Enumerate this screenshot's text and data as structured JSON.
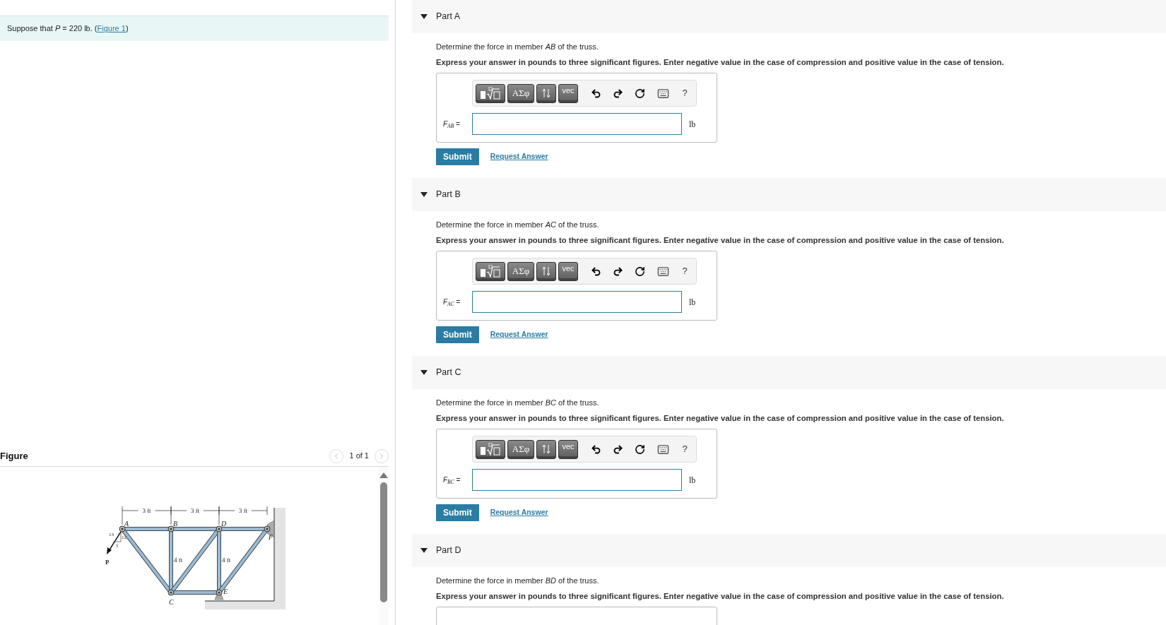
{
  "problem": {
    "text": "Suppose that *P* = 220 lb. (",
    "link": "Figure 1",
    "after": ")"
  },
  "figure": {
    "title": "Figure",
    "pager": "1 of 1",
    "prev_disabled": true,
    "next_disabled": true,
    "labels": {
      "spans": [
        "3 ft",
        "3 ft",
        "3 ft"
      ],
      "joints": [
        "A",
        "B",
        "C",
        "D",
        "E",
        "F"
      ],
      "heights": [
        "4 ft",
        "4 ft"
      ],
      "slope": [
        "13",
        "12",
        "5"
      ],
      "load": "P"
    }
  },
  "parts": [
    {
      "title": "Part A",
      "expanded": true,
      "question": "Determine the force in member *AB* of the truss.",
      "instruction": "Express your answer in pounds to three significant figures. Enter negative value in the case of compression and positive value in the case of tension.",
      "toolbar": [
        "ΑΣφ",
        "vec",
        "?"
      ],
      "answer": {
        "label": "*F*$_{AB}$ =",
        "unit": "lb"
      },
      "submit": "Submit",
      "request": "Request Answer"
    },
    {
      "title": "Part B",
      "expanded": true,
      "question": "Determine the force in member *AC* of the truss.",
      "instruction": "Express your answer in pounds to three significant figures. Enter negative value in the case of compression and positive value in the case of tension.",
      "toolbar": [
        "ΑΣφ",
        "vec",
        "?"
      ],
      "answer": {
        "label": "*F*$_{AC}$ =",
        "unit": "lb"
      },
      "submit": "Submit",
      "request": "Request Answer"
    },
    {
      "title": "Part C",
      "expanded": true,
      "question": "Determine the force in member *BC* of the truss.",
      "instruction": "Express your answer in pounds to three significant figures. Enter negative value in the case of compression and positive value in the case of tension.",
      "toolbar": [
        "ΑΣφ",
        "vec",
        "?"
      ],
      "answer": {
        "label": "*F*$_{BC}$ =",
        "unit": "lb"
      },
      "submit": "Submit",
      "request": "Request Answer"
    },
    {
      "title": "Part D",
      "expanded": true,
      "question": "Determine the force in member *BD* of the truss.",
      "instruction": "Express your answer in pounds to three significant figures. Enter negative value in the case of compression and positive value in the case of tension."
    }
  ]
}
